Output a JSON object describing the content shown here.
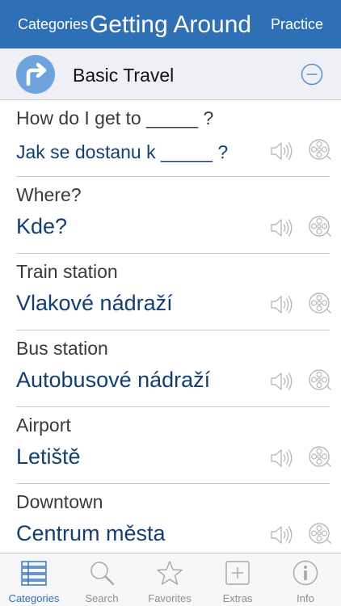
{
  "navbar": {
    "left_label": "Categories",
    "title": "Getting Around",
    "right_label": "Practice",
    "color": "#2f6fb5"
  },
  "section": {
    "label": "Basic Travel",
    "icon": "turn-right-arrow-icon",
    "action_icon": "minus-circle-icon"
  },
  "phrases": [
    {
      "english": "How do I get to _____ ?",
      "czech": "Jak se dostanu k _____ ?",
      "small": true
    },
    {
      "english": "Where?",
      "czech": "Kde?",
      "small": false
    },
    {
      "english": "Train station",
      "czech": "Vlakové nádraží",
      "small": false
    },
    {
      "english": "Bus station",
      "czech": "Autobusové nádraží",
      "small": false
    },
    {
      "english": "Airport",
      "czech": "Letiště",
      "small": false
    },
    {
      "english": "Downtown",
      "czech": "Centrum města",
      "small": false
    }
  ],
  "row_icons": {
    "play": "speaker-icon",
    "record": "film-reel-icon"
  },
  "tabs": [
    {
      "label": "Categories",
      "icon": "list-grid-icon",
      "active": true
    },
    {
      "label": "Search",
      "icon": "magnifier-icon",
      "active": false
    },
    {
      "label": "Favorites",
      "icon": "star-icon",
      "active": false
    },
    {
      "label": "Extras",
      "icon": "plus-square-icon",
      "active": false
    },
    {
      "label": "Info",
      "icon": "info-circle-icon",
      "active": false
    }
  ],
  "colors": {
    "accent": "#2f6fb5",
    "phrase_target": "#123f72",
    "inactive_tab": "#8e8e93"
  }
}
